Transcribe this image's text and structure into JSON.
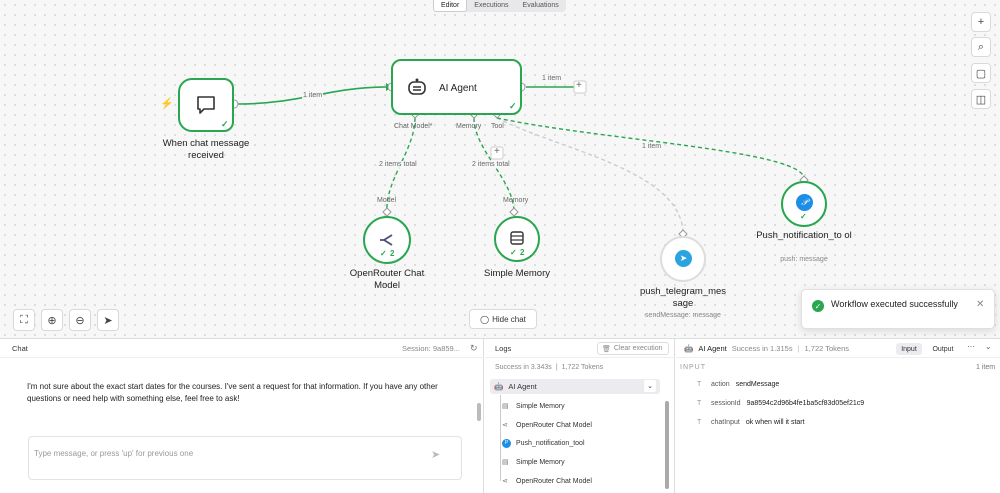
{
  "top_tabs": [
    "Editor",
    "Executions",
    "Evaluations"
  ],
  "right_toolbar": [
    "plus-icon",
    "search-icon",
    "sticky-note-icon",
    "panel-icon"
  ],
  "nodes": {
    "trigger": {
      "label": "When chat message received",
      "badge": "⚡"
    },
    "agent": {
      "label": "AI Agent",
      "handle_chat_model": "Chat Model*",
      "handle_memory": "Memory",
      "handle_tool": "Tool"
    },
    "openrouter": {
      "label": "OpenRouter Chat Model",
      "count": "2",
      "top_label": "Model"
    },
    "memory": {
      "label": "Simple Memory",
      "count": "2",
      "top_label": "Memory"
    },
    "telegram": {
      "label": "push_telegram_mes sage",
      "sub": "sendMessage: message"
    },
    "pushnotif": {
      "label": "Push_notification_to ol",
      "sub": "push: message"
    }
  },
  "edges": {
    "trigger_agent": "1 item",
    "agent_out": "1 item",
    "chat_model": "2 items total",
    "memory": "2 items total",
    "tool_push": "1 item"
  },
  "canvas_controls": {
    "hide_chat": "Hide chat"
  },
  "toast": {
    "message": "Workflow executed successfully"
  },
  "chat": {
    "title": "Chat",
    "session": "Session: 9a859...",
    "message": "I'm not sure about the exact start dates for the courses. I've sent a request for that information. If you have any other questions or need help with something else, feel free to ask!",
    "input_placeholder": "Type message, or press 'up' for previous one"
  },
  "logs": {
    "title": "Logs",
    "clear": "Clear execution",
    "success": "Success in 3.343s",
    "tokens": "1,722 Tokens",
    "root": "AI Agent",
    "items": [
      "Simple Memory",
      "OpenRouter Chat Model",
      "Push_notification_tool",
      "Simple Memory",
      "OpenRouter Chat Model"
    ]
  },
  "detail": {
    "node": "AI Agent",
    "success": "Success in 1.315s",
    "tokens": "1,722 Tokens",
    "tab_input": "Input",
    "tab_output": "Output",
    "section": "INPUT",
    "count": "1 item",
    "fields": [
      {
        "key": "action",
        "value": "sendMessage"
      },
      {
        "key": "sessionId",
        "value": "9a8594c2d96b4fe1ba5cf83d05ef21c9"
      },
      {
        "key": "chatInput",
        "value": "ok when will it start"
      }
    ]
  },
  "colors": {
    "success": "#29a650",
    "telegram": "#2aa3df",
    "push": "#1d8ee6"
  }
}
